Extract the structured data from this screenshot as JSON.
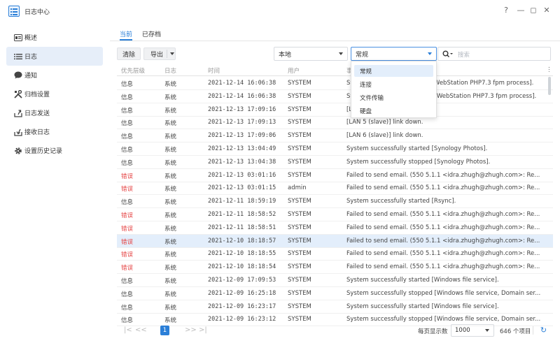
{
  "window": {
    "title": "日志中心",
    "controls": {
      "help": "?",
      "minimize": "—",
      "maximize": "◻",
      "close": "✕"
    }
  },
  "sidebar": {
    "items": [
      {
        "label": "概述",
        "icon": "overview-icon",
        "active": false
      },
      {
        "label": "日志",
        "icon": "list-icon",
        "active": true
      },
      {
        "label": "通知",
        "icon": "chat-bubble-icon",
        "active": false
      },
      {
        "label": "归档设置",
        "icon": "tools-icon",
        "active": false
      },
      {
        "label": "日志发送",
        "icon": "send-log-icon",
        "active": false
      },
      {
        "label": "接收日志",
        "icon": "receive-log-icon",
        "active": false
      },
      {
        "label": "设置历史记录",
        "icon": "gear-icon",
        "active": false
      }
    ]
  },
  "tabs": [
    {
      "label": "当前",
      "active": true
    },
    {
      "label": "已存档",
      "active": false
    }
  ],
  "toolbar": {
    "clear_label": "清除",
    "export_label": "导出",
    "source_value": "本地",
    "category_value": "常规",
    "search_placeholder": "搜索"
  },
  "category_dropdown": {
    "options": [
      "常规",
      "连接",
      "文件传输",
      "硬盘"
    ],
    "selected_index": 0
  },
  "table": {
    "columns": [
      "优先层级",
      "日志",
      "时间",
      "用户",
      "事件"
    ],
    "rows": [
      {
        "level": "信息",
        "log": "系统",
        "time": "2021-12-14 16:06:38",
        "user": "SYSTEM",
        "event": "System successfully started [WebStation PHP7.3 fpm process].",
        "error": false,
        "selected": false
      },
      {
        "level": "信息",
        "log": "系统",
        "time": "2021-12-14 16:06:38",
        "user": "SYSTEM",
        "event": "System successfully stopped [WebStation PHP7.3 fpm process].",
        "error": false,
        "selected": false
      },
      {
        "level": "信息",
        "log": "系统",
        "time": "2021-12-13 17:09:16",
        "user": "SYSTEM",
        "event": "[LAN 5 (slave)] link up.",
        "error": false,
        "selected": false
      },
      {
        "level": "信息",
        "log": "系统",
        "time": "2021-12-13 17:09:13",
        "user": "SYSTEM",
        "event": "[LAN 5 (slave)] link down.",
        "error": false,
        "selected": false
      },
      {
        "level": "信息",
        "log": "系统",
        "time": "2021-12-13 17:09:06",
        "user": "SYSTEM",
        "event": "[LAN 6 (slave)] link down.",
        "error": false,
        "selected": false
      },
      {
        "level": "信息",
        "log": "系统",
        "time": "2021-12-13 13:04:49",
        "user": "SYSTEM",
        "event": "System successfully started [Synology Photos].",
        "error": false,
        "selected": false
      },
      {
        "level": "信息",
        "log": "系统",
        "time": "2021-12-13 13:04:38",
        "user": "SYSTEM",
        "event": "System successfully stopped [Synology Photos].",
        "error": false,
        "selected": false
      },
      {
        "level": "错误",
        "log": "系统",
        "time": "2021-12-13 03:01:16",
        "user": "SYSTEM",
        "event": "Failed to send email. (550 5.1.1 <idra.zhugh@zhugh.com>: Re...",
        "error": true,
        "selected": false
      },
      {
        "level": "错误",
        "log": "系统",
        "time": "2021-12-13 03:01:15",
        "user": "admin",
        "event": "Failed to send email. (550 5.1.1 <idra.zhugh@zhugh.com>: Re...",
        "error": true,
        "selected": false
      },
      {
        "level": "信息",
        "log": "系统",
        "time": "2021-12-11 18:59:19",
        "user": "SYSTEM",
        "event": "System successfully started [Rsync].",
        "error": false,
        "selected": false
      },
      {
        "level": "错误",
        "log": "系统",
        "time": "2021-12-11 18:58:52",
        "user": "SYSTEM",
        "event": "Failed to send email. (550 5.1.1 <idra.zhugh@zhugh.com>: Re...",
        "error": true,
        "selected": false
      },
      {
        "level": "错误",
        "log": "系统",
        "time": "2021-12-11 18:58:51",
        "user": "SYSTEM",
        "event": "Failed to send email. (550 5.1.1 <idra.zhugh@zhugh.com>: Re...",
        "error": true,
        "selected": false
      },
      {
        "level": "错误",
        "log": "系统",
        "time": "2021-12-10 18:18:57",
        "user": "SYSTEM",
        "event": "Failed to send email. (550 5.1.1 <idra.zhugh@zhugh.com>: Re...",
        "error": true,
        "selected": true
      },
      {
        "level": "错误",
        "log": "系统",
        "time": "2021-12-10 18:18:55",
        "user": "SYSTEM",
        "event": "Failed to send email. (550 5.1.1 <idra.zhugh@zhugh.com>: Re...",
        "error": true,
        "selected": false
      },
      {
        "level": "错误",
        "log": "系统",
        "time": "2021-12-10 18:18:54",
        "user": "SYSTEM",
        "event": "Failed to send email. (550 5.1.1 <idra.zhugh@zhugh.com>: Re...",
        "error": true,
        "selected": false
      },
      {
        "level": "信息",
        "log": "系统",
        "time": "2021-12-09 17:09:53",
        "user": "SYSTEM",
        "event": "System successfully started [Windows file service].",
        "error": false,
        "selected": false
      },
      {
        "level": "信息",
        "log": "系统",
        "time": "2021-12-09 16:25:18",
        "user": "SYSTEM",
        "event": "System successfully stopped [Windows file service, Domain ser...",
        "error": false,
        "selected": false
      },
      {
        "level": "信息",
        "log": "系统",
        "time": "2021-12-09 16:23:17",
        "user": "SYSTEM",
        "event": "System successfully started [Windows file service].",
        "error": false,
        "selected": false
      },
      {
        "level": "信息",
        "log": "系统",
        "time": "2021-12-09 16:23:12",
        "user": "SYSTEM",
        "event": "System successfully stopped [Windows file service, Domain ser...",
        "error": false,
        "selected": false
      }
    ]
  },
  "pagination": {
    "first": "|<",
    "prev": "<<",
    "current_page": "1",
    "next": ">>",
    "last": ">|",
    "per_page_label": "每页显示数",
    "per_page_value": "1000",
    "total_text": "646 个项目"
  },
  "colors": {
    "accent": "#2b7fd8",
    "error": "#e54545",
    "selected_row": "#e3eefb",
    "sidebar_active": "#e6eef9"
  }
}
